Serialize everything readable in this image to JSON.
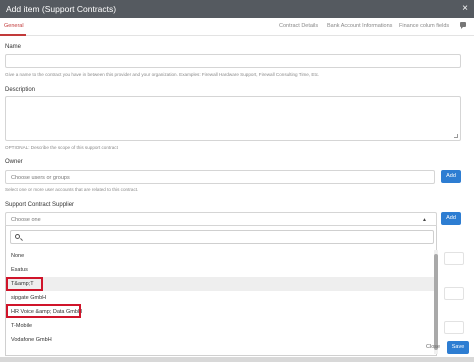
{
  "dialog": {
    "title": "Add item (Support Contracts)",
    "close_glyph": "×"
  },
  "tabs": {
    "general": "General",
    "contract_details": "Contract Details",
    "bank_account": "Bank Account Informations",
    "finance": "Finance colum fields"
  },
  "form": {
    "name_label": "Name",
    "name_help": "Give a name to the contract you have in between this provider and your organization. Examples: Firewall Hardware Support, Firewall Consulting Time, Etc.",
    "description_label": "Description",
    "description_help": "OPTIONAL: Describe the scope of this support contract",
    "owner_label": "Owner",
    "owner_placeholder": "Choose users or groups",
    "owner_help": "Select one or more user accounts that are related to this contract.",
    "owner_add": "Add",
    "supplier_label": "Support Contract Supplier",
    "supplier_placeholder": "Choose one",
    "supplier_add": "Add"
  },
  "dropdown": {
    "search_value": "",
    "options": [
      "None",
      "Esatus",
      "T&amp;T",
      "sipgate GmbH",
      "HR Voice &amp; Data GmbH",
      "T-Mobile",
      "Vodafone GmbH"
    ]
  },
  "footer": {
    "close": "Close",
    "save": "Save"
  }
}
